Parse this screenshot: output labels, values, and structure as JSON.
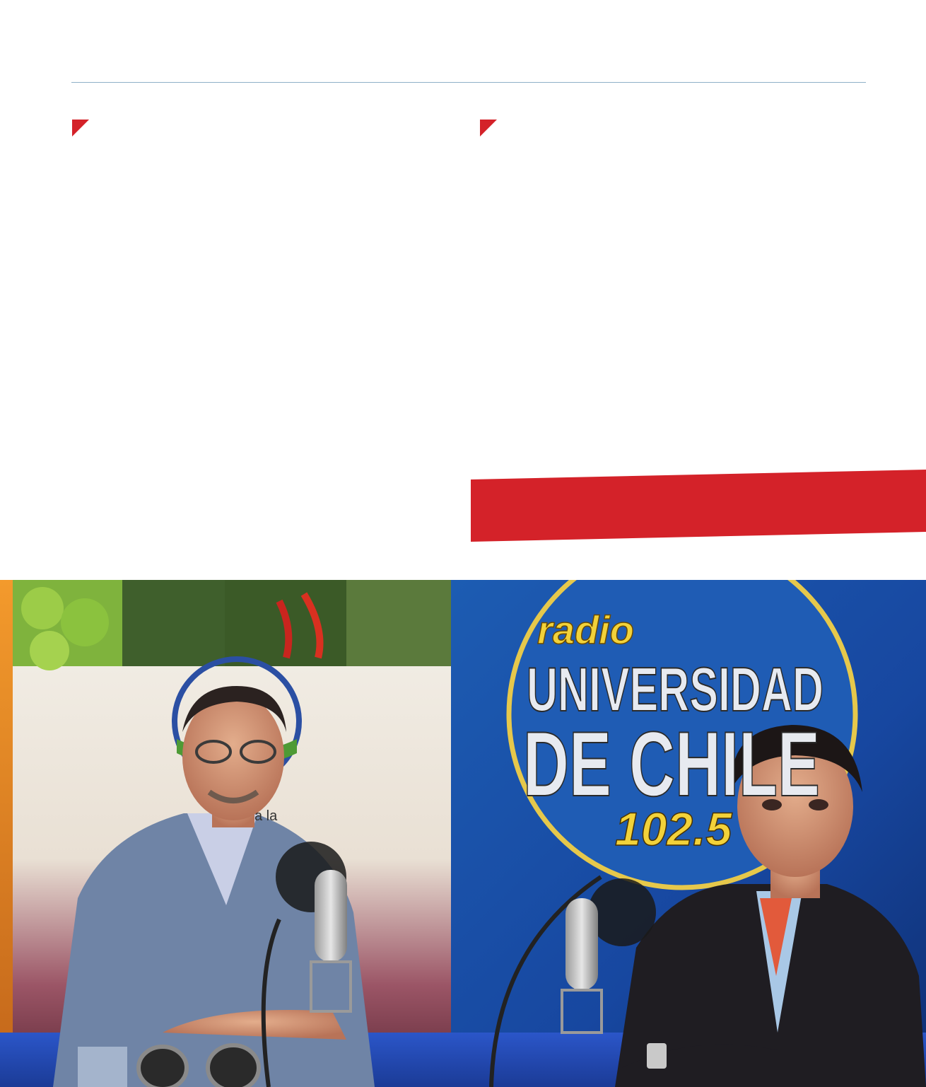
{
  "colors": {
    "accent": "#d42229",
    "rule": "#8fb1c8"
  },
  "photo": {
    "backdrop_left_text": "a la",
    "backdrop_right_word1": "radio",
    "backdrop_right_word2": "UNIVERSIDAD",
    "backdrop_right_word3": "DE CHILE",
    "backdrop_right_freq": "102.5"
  }
}
